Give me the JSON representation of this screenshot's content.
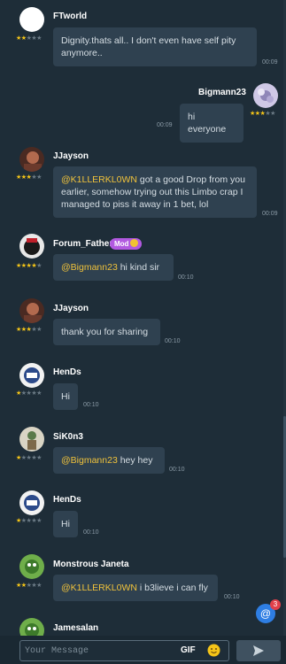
{
  "colors": {
    "background": "#1e2d38",
    "bubble": "#2f4150",
    "mention": "#f0c23b",
    "star": "#f5c518",
    "mod_badge": "#b259e0",
    "notification": "#2e7ee3"
  },
  "messages": [
    {
      "user": "FTworld",
      "rating": 2.5,
      "text": "Dignity.thats all.. I don't even have self pity anymore..",
      "time": "00:09",
      "avatar_icon": "blank-avatar-icon"
    },
    {
      "user": "Bigmann23",
      "rating": 3,
      "text": "hi everyone",
      "time": "00:09",
      "avatar_icon": "flower-avatar-icon"
    },
    {
      "user": "JJayson",
      "rating": 3,
      "mention": "@K1LLERKL0WN",
      "text": "  got a good Drop from you earlier, somehow trying out this Limbo crap I managed to piss it away in 1 bet, lol",
      "time": "00:09",
      "avatar_icon": "portrait-avatar-icon"
    },
    {
      "user": "Forum_Father",
      "rating": 4,
      "badge": "Mod",
      "mention": "@Bigmann23",
      "text": " hi kind sir",
      "time": "00:10",
      "avatar_icon": "character-avatar-icon"
    },
    {
      "user": "JJayson",
      "rating": 3,
      "text": "thank you for sharing",
      "time": "00:10",
      "avatar_icon": "portrait-avatar-icon"
    },
    {
      "user": "HenDs",
      "rating": 1.5,
      "text": "Hi",
      "time": "00:10",
      "avatar_icon": "logo-avatar-icon"
    },
    {
      "user": "SiK0n3",
      "rating": 1.5,
      "mention": "@Bigmann23",
      "text": " hey hey",
      "time": "00:10",
      "avatar_icon": "figure-avatar-icon"
    },
    {
      "user": "HenDs",
      "rating": 1.5,
      "text": "Hi",
      "time": "00:10",
      "avatar_icon": "logo-avatar-icon"
    },
    {
      "user": "Monstrous Janeta",
      "rating": 2.5,
      "mention": "@K1LLERKL0WN",
      "text": " i b3lieve i can fly",
      "time": "00:10",
      "avatar_icon": "creature-avatar-icon"
    },
    {
      "user": "Jamesalan",
      "avatar_icon": "creature-avatar-icon"
    }
  ],
  "notification": {
    "icon": "at-icon",
    "count": "3"
  },
  "composer": {
    "placeholder": "Your Message",
    "gif_label": "GIF",
    "emoji_icon": "smiley-icon",
    "send_icon": "send-arrow-icon"
  }
}
